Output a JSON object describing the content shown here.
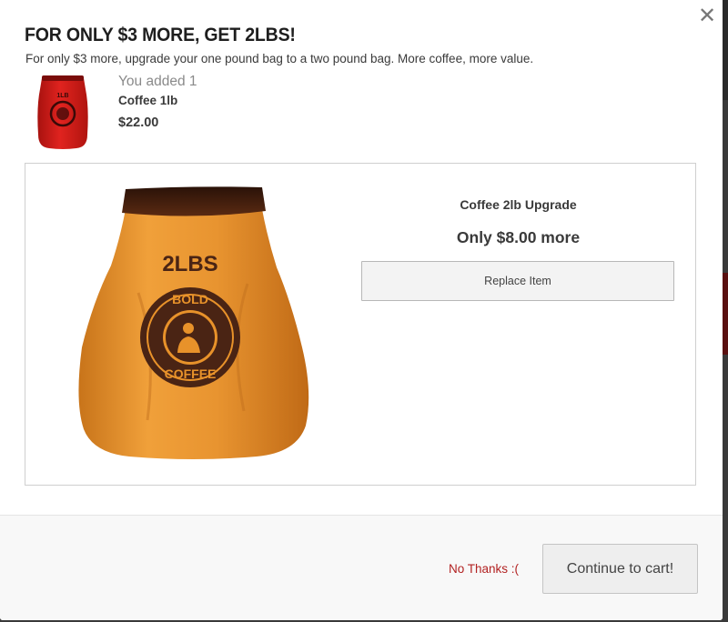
{
  "modal": {
    "title": "FOR ONLY $3 MORE, GET 2LBS!",
    "subtitle": "For only $3 more, upgrade your one pound bag to a two pound bag. More coffee, more value.",
    "close_glyph": "✕"
  },
  "added_item": {
    "label": "You added 1",
    "name": "Coffee 1lb",
    "price": "$22.00",
    "bag_text": "1LB",
    "bag_color": "#d8201e"
  },
  "upsell": {
    "name": "Coffee 2lb Upgrade",
    "price_text": "Only $8.00 more",
    "button_label": "Replace Item",
    "bag_text": "2LBS",
    "logo_top": "BOLD",
    "logo_bottom": "COFFEE",
    "bag_color": "#e8922a",
    "logo_color": "#4a2414"
  },
  "footer": {
    "decline_label": "No Thanks :(",
    "continue_label": "Continue to cart!"
  },
  "colors": {
    "decline_link": "#b22222",
    "overlay": "#3a3a3a"
  }
}
